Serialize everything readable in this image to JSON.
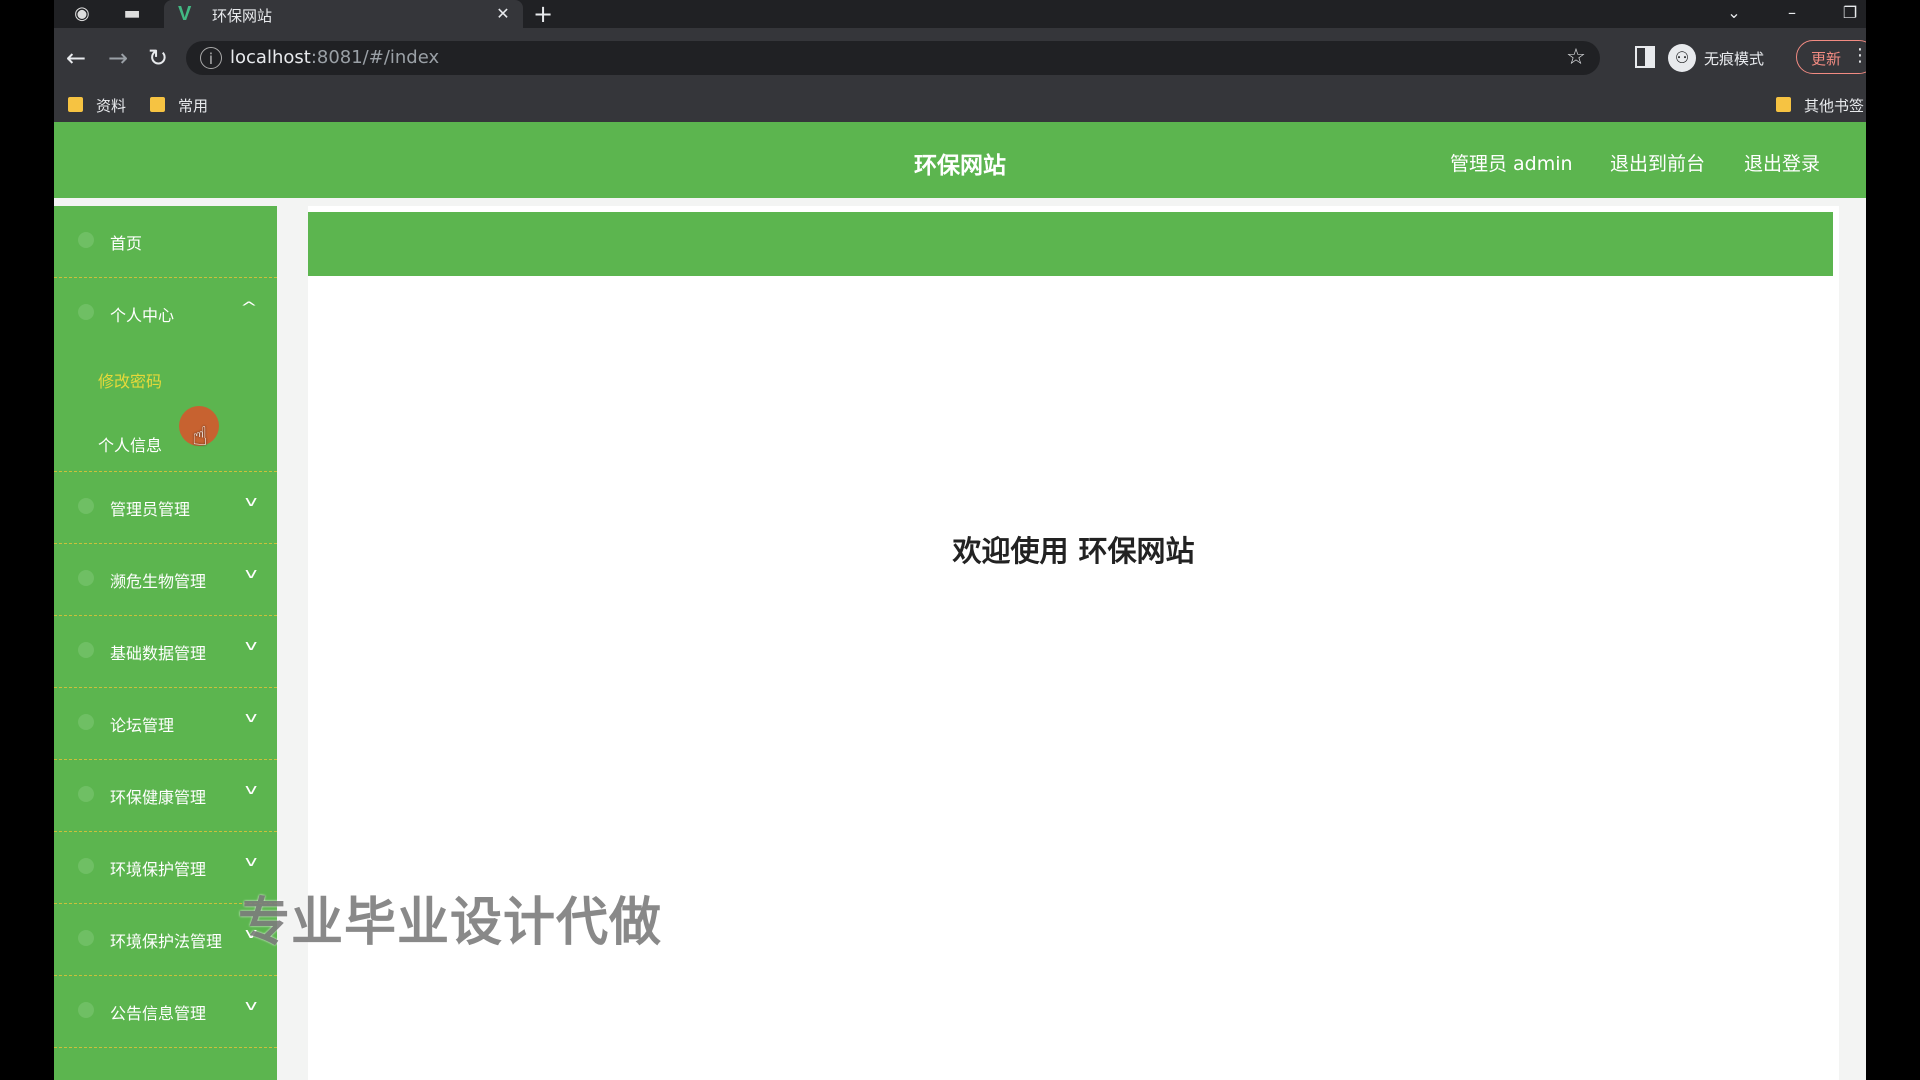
{
  "browser": {
    "tab_title": "环保网站",
    "tab_favicon": "V",
    "url_host": "localhost",
    "url_rest": ":8081/#/index",
    "incognito_label": "无痕模式",
    "update_label": "更新",
    "bookmarks": [
      {
        "label": "资料"
      },
      {
        "label": "常用"
      }
    ],
    "other_bookmarks": "其他书签"
  },
  "header": {
    "title": "环保网站",
    "user": "管理员 admin",
    "front_link": "退出到前台",
    "logout_link": "退出登录"
  },
  "sidebar": {
    "home": "首页",
    "personal_center": "个人中心",
    "sub_change_password": "修改密码",
    "sub_personal_info": "个人信息",
    "items": [
      {
        "label": "管理员管理"
      },
      {
        "label": "濒危生物管理"
      },
      {
        "label": "基础数据管理"
      },
      {
        "label": "论坛管理"
      },
      {
        "label": "环保健康管理"
      },
      {
        "label": "环境保护管理"
      },
      {
        "label": "环境保护法管理"
      },
      {
        "label": "公告信息管理"
      }
    ]
  },
  "main": {
    "welcome": "欢迎使用 环保网站"
  },
  "overlay": {
    "watermark": "专业毕业设计代做"
  },
  "colors": {
    "primary": "#5cb54f",
    "active_sub": "#e6d93a"
  }
}
